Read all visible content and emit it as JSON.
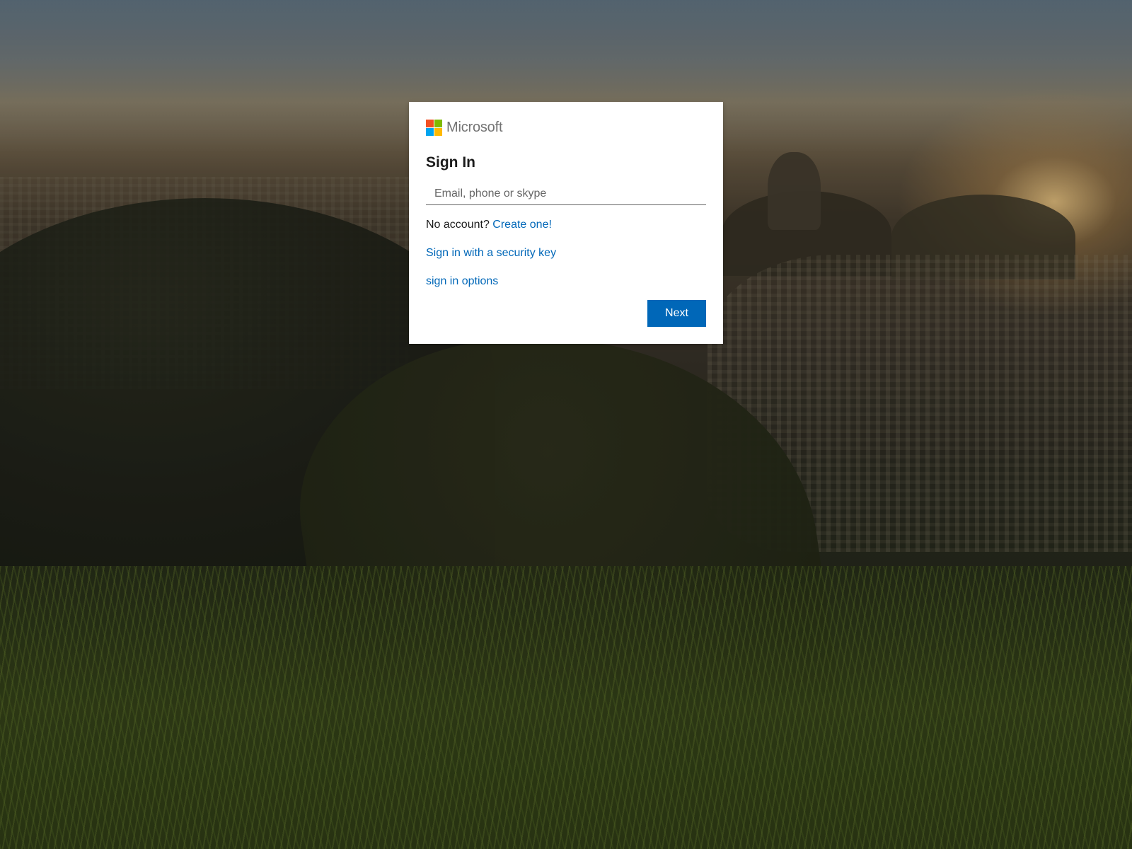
{
  "brand": {
    "name": "Microsoft",
    "logo_colors": [
      "#f25022",
      "#7fba00",
      "#00a4ef",
      "#ffb900"
    ]
  },
  "signin": {
    "title": "Sign In",
    "email_placeholder": "Email, phone or skype",
    "email_value": "",
    "no_account_text": "No account?",
    "create_link": "Create one!",
    "security_key_link": "Sign in with a security key",
    "options_link": "sign in options",
    "next_label": "Next"
  },
  "colors": {
    "accent": "#0067b8",
    "card_background": "#ffffff",
    "brand_text": "#737373"
  }
}
